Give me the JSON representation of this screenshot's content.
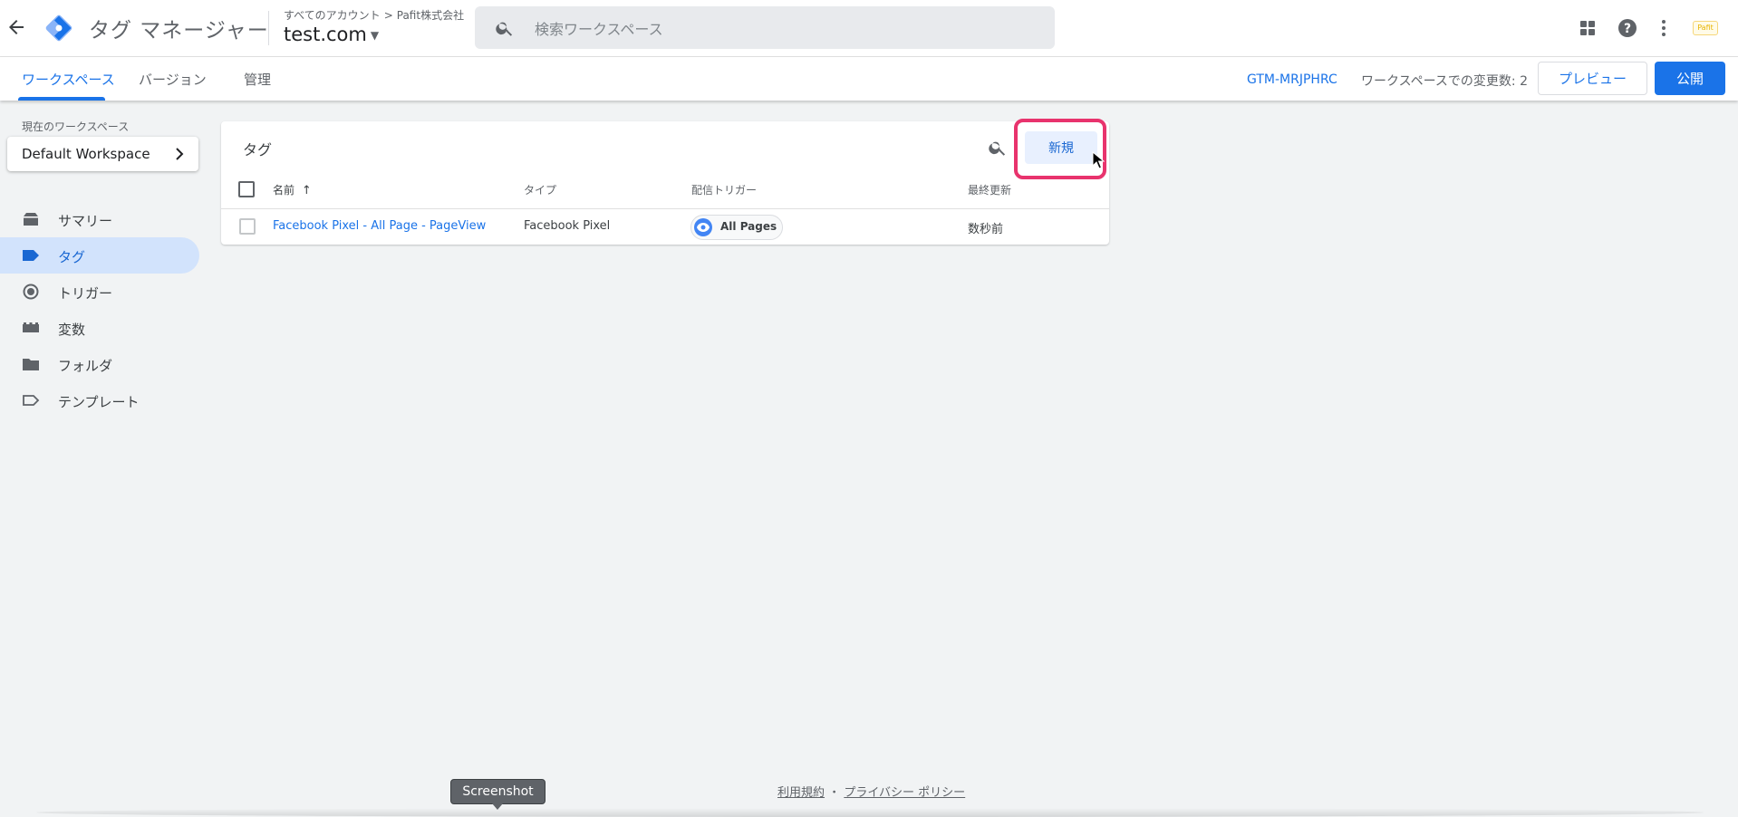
{
  "header": {
    "app_title": "タグ マネージャー",
    "breadcrumb_all_accounts": "すべてのアカウント",
    "breadcrumb_separator": ">",
    "breadcrumb_account": "Pafit株式会社",
    "container_name": "test.com",
    "search_placeholder": "検索ワークスペース",
    "account_badge": "Pafit"
  },
  "nav": {
    "tabs": [
      {
        "label": "ワークスペース",
        "active": true
      },
      {
        "label": "バージョン",
        "active": false
      },
      {
        "label": "管理",
        "active": false
      }
    ],
    "container_id": "GTM-MRJPHRC",
    "workspace_changes": "ワークスペースでの変更数: 2",
    "preview_label": "プレビュー",
    "publish_label": "公開"
  },
  "sidebar": {
    "current_workspace_label": "現在のワークスペース",
    "workspace_name": "Default Workspace",
    "items": [
      {
        "label": "サマリー",
        "icon": "summary-icon",
        "active": false
      },
      {
        "label": "タグ",
        "icon": "tag-icon",
        "active": true
      },
      {
        "label": "トリガー",
        "icon": "trigger-icon",
        "active": false
      },
      {
        "label": "変数",
        "icon": "variable-icon",
        "active": false
      },
      {
        "label": "フォルダ",
        "icon": "folder-icon",
        "active": false
      },
      {
        "label": "テンプレート",
        "icon": "template-icon",
        "active": false
      }
    ]
  },
  "tags_card": {
    "title": "タグ",
    "new_button_label": "新規",
    "columns": {
      "name": "名前",
      "type": "タイプ",
      "trigger": "配信トリガー",
      "last_edited": "最終更新"
    },
    "rows": [
      {
        "name": "Facebook Pixel - All Page - PageView",
        "type": "Facebook Pixel",
        "trigger": "All Pages",
        "last_edited": "数秒前"
      }
    ]
  },
  "footer": {
    "terms": "利用規約",
    "separator": "・",
    "privacy": "プライバシー ポリシー",
    "tooltip": "Screenshot"
  },
  "colors": {
    "accent": "#1a73e8",
    "highlight": "#e8336d",
    "background": "#f1f3f4"
  }
}
